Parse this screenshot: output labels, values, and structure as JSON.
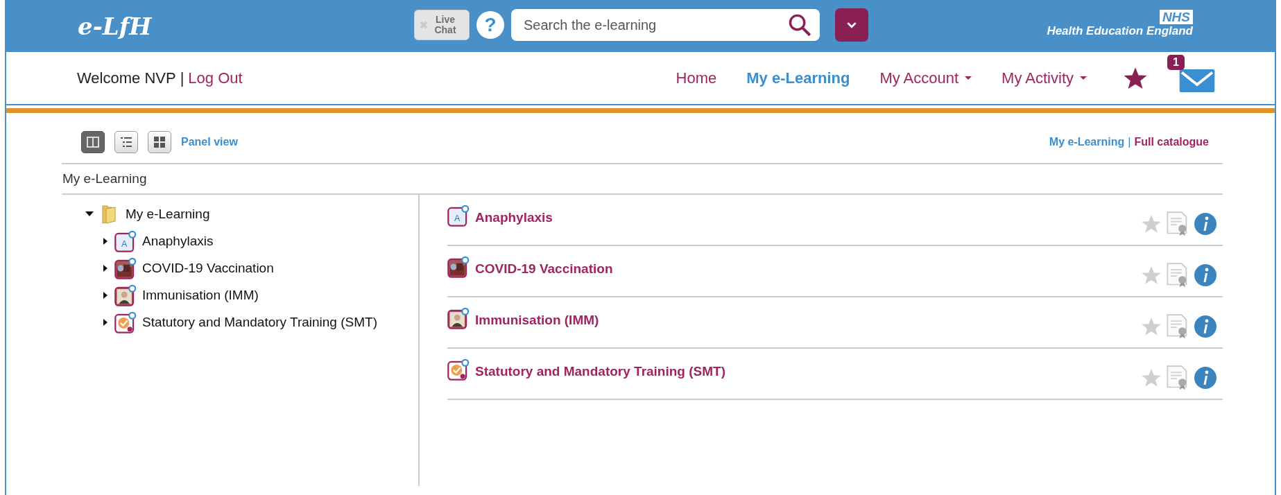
{
  "header": {
    "logo": "e-LfH",
    "live_chat": "Live Chat",
    "help": "?",
    "search": {
      "placeholder": "Search the e-learning"
    },
    "brand_badge": "NHS",
    "brand_name": "Health Education England"
  },
  "user_bar": {
    "welcome": "Welcome NVP",
    "separator": "|",
    "logout": "Log Out"
  },
  "nav": [
    {
      "label": "Home",
      "selected": false,
      "dropdown": false
    },
    {
      "label": "My e-Learning",
      "selected": true,
      "dropdown": false
    },
    {
      "label": "My Account",
      "selected": false,
      "dropdown": true
    },
    {
      "label": "My Activity",
      "selected": false,
      "dropdown": true
    }
  ],
  "messages": {
    "count": "1"
  },
  "toolbar": {
    "views": [
      {
        "kind": "panel",
        "selected": true
      },
      {
        "kind": "list",
        "selected": false
      },
      {
        "kind": "grid",
        "selected": false
      }
    ],
    "view_label": "Panel view",
    "links": [
      {
        "label": "My e-Learning",
        "selected": true
      },
      {
        "label": "Full catalogue",
        "selected": false
      }
    ],
    "separator": "|"
  },
  "breadcrumb": "My e-Learning",
  "tree": {
    "label": "My e-Learning",
    "expanded": true,
    "children": [
      {
        "label": "Anaphylaxis",
        "kind": "letter",
        "icon_text": "A",
        "expanded": false
      },
      {
        "label": "COVID-19 Vaccination",
        "kind": "photo",
        "expanded": false
      },
      {
        "label": "Immunisation (IMM)",
        "kind": "portrait",
        "expanded": false
      },
      {
        "label": "Statutory and Mandatory Training (SMT)",
        "kind": "check",
        "expanded": false
      }
    ]
  },
  "courses": [
    {
      "title": "Anaphylaxis",
      "kind": "letter",
      "icon_text": "A",
      "favourite": false
    },
    {
      "title": "COVID-19 Vaccination",
      "kind": "photo",
      "favourite": false
    },
    {
      "title": "Immunisation (IMM)",
      "kind": "portrait",
      "favourite": false
    },
    {
      "title": "Statutory and Mandatory Training (SMT)",
      "kind": "check",
      "favourite": false
    }
  ]
}
